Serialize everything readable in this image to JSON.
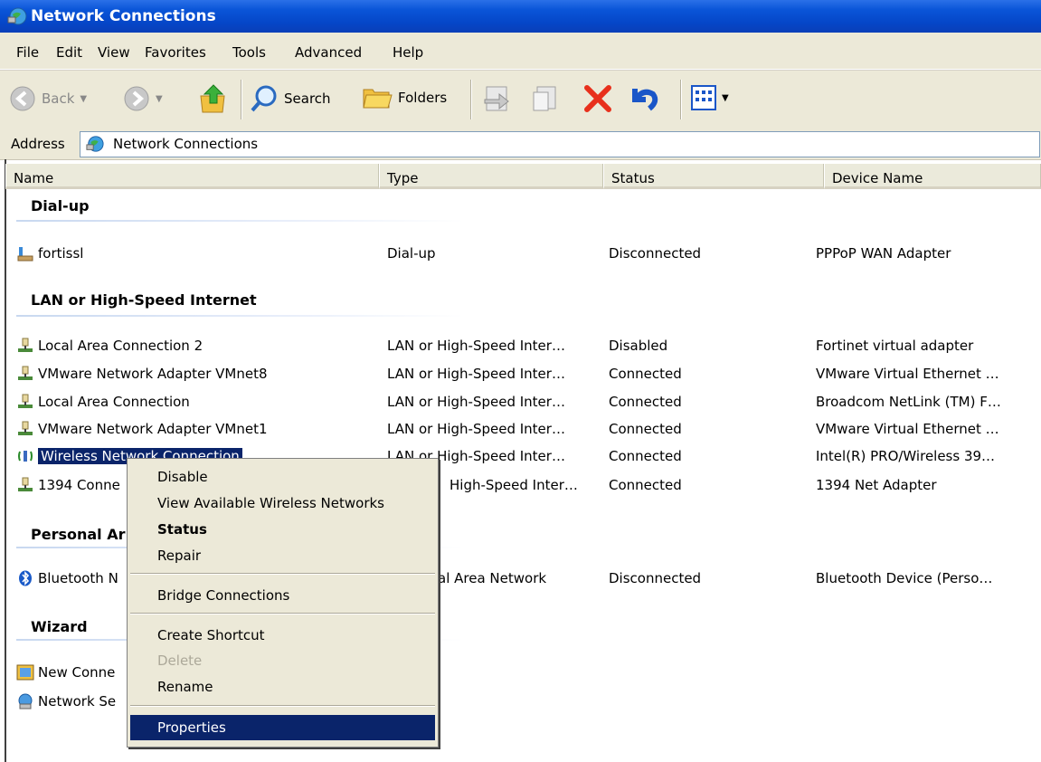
{
  "window": {
    "title": "Network Connections"
  },
  "menu": [
    "File",
    "Edit",
    "View",
    "Favorites",
    "Tools",
    "Advanced",
    "Help"
  ],
  "toolbar": {
    "back": "Back",
    "search": "Search",
    "folders": "Folders"
  },
  "address": {
    "label": "Address",
    "value": "Network Connections"
  },
  "columns": [
    "Name",
    "Type",
    "Status",
    "Device Name"
  ],
  "groups": {
    "dialup": {
      "title": "Dial-up",
      "rows": [
        {
          "name": "fortissl",
          "type": "Dial-up",
          "status": "Disconnected",
          "device": "PPPoP WAN Adapter"
        }
      ]
    },
    "lan": {
      "title": "LAN or High-Speed Internet",
      "rows": [
        {
          "name": "Local Area Connection 2",
          "type": "LAN or High-Speed Inter…",
          "status": "Disabled",
          "device": "Fortinet virtual adapter"
        },
        {
          "name": "VMware Network Adapter VMnet8",
          "type": "LAN or High-Speed Inter…",
          "status": "Connected",
          "device": "VMware Virtual Ethernet …"
        },
        {
          "name": "Local Area Connection",
          "type": "LAN or High-Speed Inter…",
          "status": "Connected",
          "device": "Broadcom NetLink (TM) F…"
        },
        {
          "name": "VMware Network Adapter VMnet1",
          "type": "LAN or High-Speed Inter…",
          "status": "Connected",
          "device": "VMware Virtual Ethernet …"
        },
        {
          "name": "Wireless Network Connection",
          "type": "LAN or High-Speed Inter…",
          "status": "Connected",
          "device": "Intel(R) PRO/Wireless 39…"
        },
        {
          "name": "1394 Conne",
          "type": "High-Speed Inter…",
          "status": "Connected",
          "device": "1394 Net Adapter"
        }
      ]
    },
    "personal": {
      "title": "Personal Ar",
      "rows": [
        {
          "name": "Bluetooth N",
          "type": "al Area Network",
          "status": "Disconnected",
          "device": "Bluetooth Device (Perso…"
        }
      ]
    },
    "wizard": {
      "title": "Wizard",
      "rows": [
        {
          "name": "New Conne"
        },
        {
          "name": "Network Se"
        }
      ]
    }
  },
  "context_menu": {
    "disable": "Disable",
    "view_wireless": "View Available Wireless Networks",
    "status": "Status",
    "repair": "Repair",
    "bridge": "Bridge Connections",
    "create_shortcut": "Create Shortcut",
    "delete": "Delete",
    "rename": "Rename",
    "properties": "Properties"
  },
  "colors": {
    "titlebar": "#0a55d8",
    "chrome": "#ece9d8",
    "selection": "#0a246a"
  }
}
